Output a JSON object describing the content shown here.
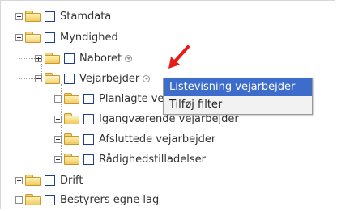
{
  "tree": {
    "items": [
      {
        "label": "Stamdata",
        "expanded": false
      },
      {
        "label": "Myndighed",
        "expanded": true
      },
      {
        "label": "Naboret",
        "expanded": false
      },
      {
        "label": "Vejarbejder",
        "expanded": true
      },
      {
        "label": "Planlagte vejarbejder",
        "expanded": false
      },
      {
        "label": "Igangværende vejarbejder",
        "expanded": false
      },
      {
        "label": "Afsluttede vejarbejder",
        "expanded": false
      },
      {
        "label": "Rådighedstilladelser",
        "expanded": false
      },
      {
        "label": "Drift",
        "expanded": false
      },
      {
        "label": "Bestyrers egne lag",
        "expanded": false
      }
    ]
  },
  "context_menu": {
    "items": [
      {
        "label": "Listevisning vejarbejder",
        "highlighted": true
      },
      {
        "label": "Tilføj filter",
        "highlighted": false
      }
    ]
  },
  "colors": {
    "menu_highlight": "#3d6ccb",
    "arrow": "#e81a1a",
    "checkbox_border": "#1e3f8f"
  },
  "icons": [
    "expand-plus-icon",
    "collapse-minus-icon",
    "folder-icon",
    "open-folder-icon",
    "checkbox-icon",
    "info-dropdown-icon",
    "red-arrow-icon"
  ]
}
